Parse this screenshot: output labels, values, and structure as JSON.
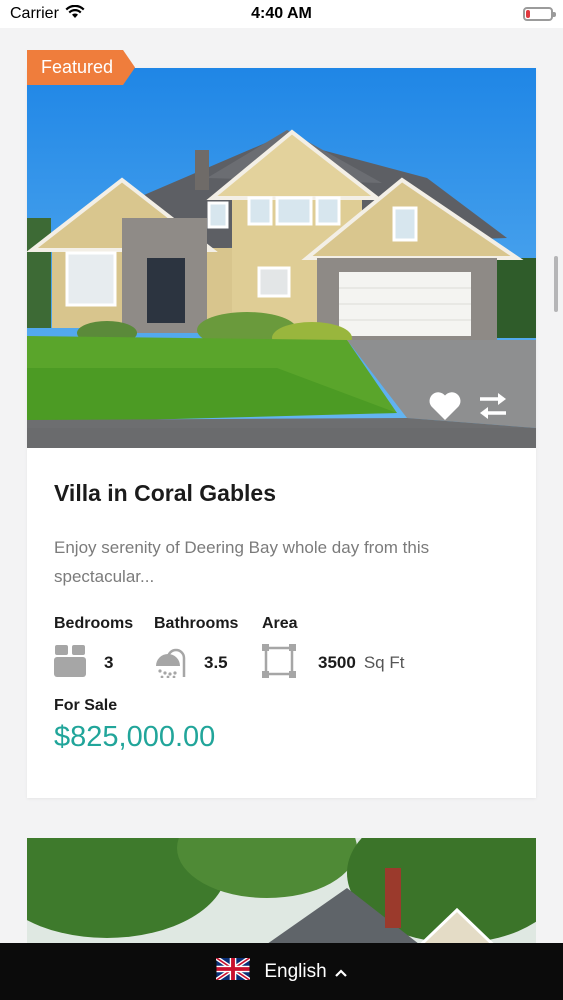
{
  "status_bar": {
    "carrier": "Carrier",
    "time": "4:40 AM",
    "battery_level_fraction": 0.15,
    "battery_color": "#e0383e"
  },
  "listing": {
    "badge": "Featured",
    "title": "Villa in Coral Gables",
    "description": "Enjoy serenity of Deering Bay whole day from this spectacular...",
    "features": {
      "bedrooms_label": "Bedrooms",
      "bathrooms_label": "Bathrooms",
      "area_label": "Area",
      "bedrooms_value": "3",
      "bathrooms_value": "3.5",
      "area_value": "3500",
      "area_unit": "Sq Ft"
    },
    "status": "For Sale",
    "price": "$825,000.00",
    "price_color": "#21a59a",
    "badge_color": "#ef7d3c",
    "icons": [
      "heart-icon",
      "compare-icon",
      "bed-icon",
      "shower-icon",
      "area-icon"
    ]
  },
  "language_bar": {
    "flag": "uk-flag-icon",
    "language": "English"
  }
}
